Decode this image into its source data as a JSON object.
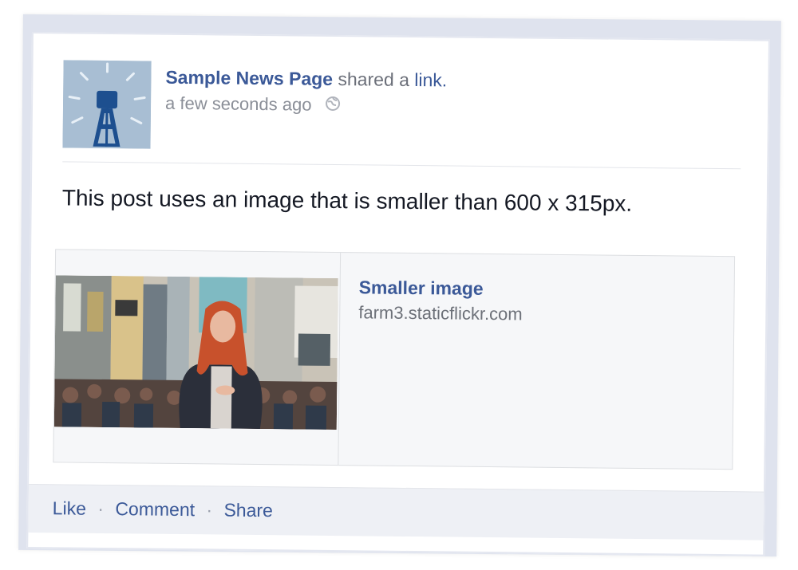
{
  "post": {
    "author": "Sample News Page",
    "action_text": "shared a",
    "action_link": "link.",
    "timestamp": "a few seconds ago",
    "privacy_icon": "globe-icon",
    "text": "This post uses an image that is smaller than 600 x 315px."
  },
  "attachment": {
    "title": "Smaller image",
    "domain": "farm3.staticflickr.com",
    "thumbnail_icon": "photo-thumbnail"
  },
  "actions": {
    "like": "Like",
    "comment": "Comment",
    "share": "Share",
    "separator": "·"
  },
  "colors": {
    "link": "#3b5998",
    "secondary_text": "#8b8f98",
    "body_text": "#141823",
    "attachment_bg": "#f6f7f9",
    "action_bar_bg": "#eef0f5"
  }
}
